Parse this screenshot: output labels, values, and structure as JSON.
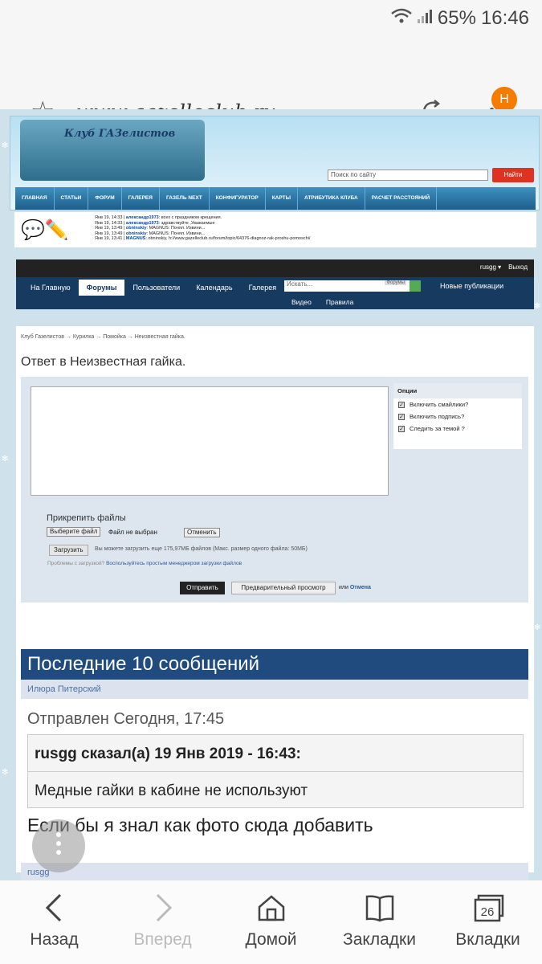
{
  "status": {
    "battery": "65%",
    "time": "16:46"
  },
  "browser": {
    "url": "www.gazelleclub.ru",
    "badge": "H"
  },
  "site": {
    "logo_line1": "Клуб",
    "logo_line2": "ГАЗелистов",
    "search_placeholder": "Поиск по сайту",
    "search_button": "Найти",
    "menu": [
      "ГЛАВНАЯ",
      "СТАТЬИ",
      "ФОРУМ",
      "ГАЛЕРЕЯ",
      "ГАЗЕЛЬ NEXT",
      "КОНФИГУРАТОР",
      "КАРТЫ",
      "АТРИБУТИКА КЛУБА",
      "РАСЧЕТ РАССТОЯНИЙ"
    ],
    "shout": [
      {
        "t": "Янв 19, 14:33",
        "u": "александр1973",
        "m": "всех с праздником крещения."
      },
      {
        "t": "Янв 19, 14:33",
        "u": "александр1973",
        "m": "здравствуйте ,Уважаемые"
      },
      {
        "t": "Янв 19, 13:49",
        "u": "obninskiy",
        "m": "MAGNUS: Понял. Извини..."
      },
      {
        "t": "Янв 19, 13:49",
        "u": "obninskiy",
        "m": "MAGNUS: Понял. Извини..."
      },
      {
        "t": "Янв 19, 13:41",
        "u": "MAGNUS",
        "m": "obninskiy, h://www.gazelleclub.ru/forum/topic/64376-diagnoz-rak-proshu-pomoschi/"
      }
    ]
  },
  "forum": {
    "user": "rusgg ▾",
    "logout": "Выход",
    "tabs": [
      "На Главную",
      "Форумы",
      "Пользователи",
      "Календарь",
      "Галерея"
    ],
    "search_placeholder": "Искать...",
    "search_scope": "Форумы",
    "new_posts": "Новые публикации",
    "subtabs": [
      "Видео",
      "Правила"
    ],
    "breadcrumb": "Клуб Газелистов → Курилка → Помойка → Неизвестная гайка.",
    "reply_title": "Ответ в Неизвестная гайка.",
    "attach_label": "Прикрепить файлы",
    "choose_file": "Выберите файл",
    "no_file": "Файл не выбран",
    "cancel": "Отменить",
    "upload": "Загрузить",
    "upload_note": "Вы можете загрузить еще 175,97МБ файлов (Макс. размер одного файла: 50МБ)",
    "problem_text": "Проблемы с загрузкой?",
    "problem_link": "Воспользуйтесь простым менеджером загрузки файлов",
    "options_title": "Опции",
    "options": [
      "Включить смайлики?",
      "Включить подпись?",
      "Следить за темой ?"
    ],
    "send": "Отправить",
    "preview": "Предварительный просмотр",
    "or": "или",
    "or_cancel": "Отмена",
    "last10_title": "Последние 10 сообщений",
    "post1_author": "Илюра Питерский",
    "post1_sent": "Отправлен Сегодня, 17:45",
    "quote_head": "rusgg сказал(а) 19 Янв 2019 - 16:43:",
    "quote_body": "Медные гайки в кабине не используют",
    "post1_msg": "Если бы я знал как фото сюда добавить",
    "post2_author": "rusgg"
  },
  "bottom_nav": [
    {
      "label": "Назад",
      "icon": "back-icon",
      "enabled": true
    },
    {
      "label": "Вперед",
      "icon": "forward-icon",
      "enabled": false
    },
    {
      "label": "Домой",
      "icon": "home-icon",
      "enabled": true
    },
    {
      "label": "Закладки",
      "icon": "bookmarks-icon",
      "enabled": true
    },
    {
      "label": "Вкладки",
      "icon": "tabs-icon",
      "enabled": true,
      "count": "26"
    }
  ]
}
